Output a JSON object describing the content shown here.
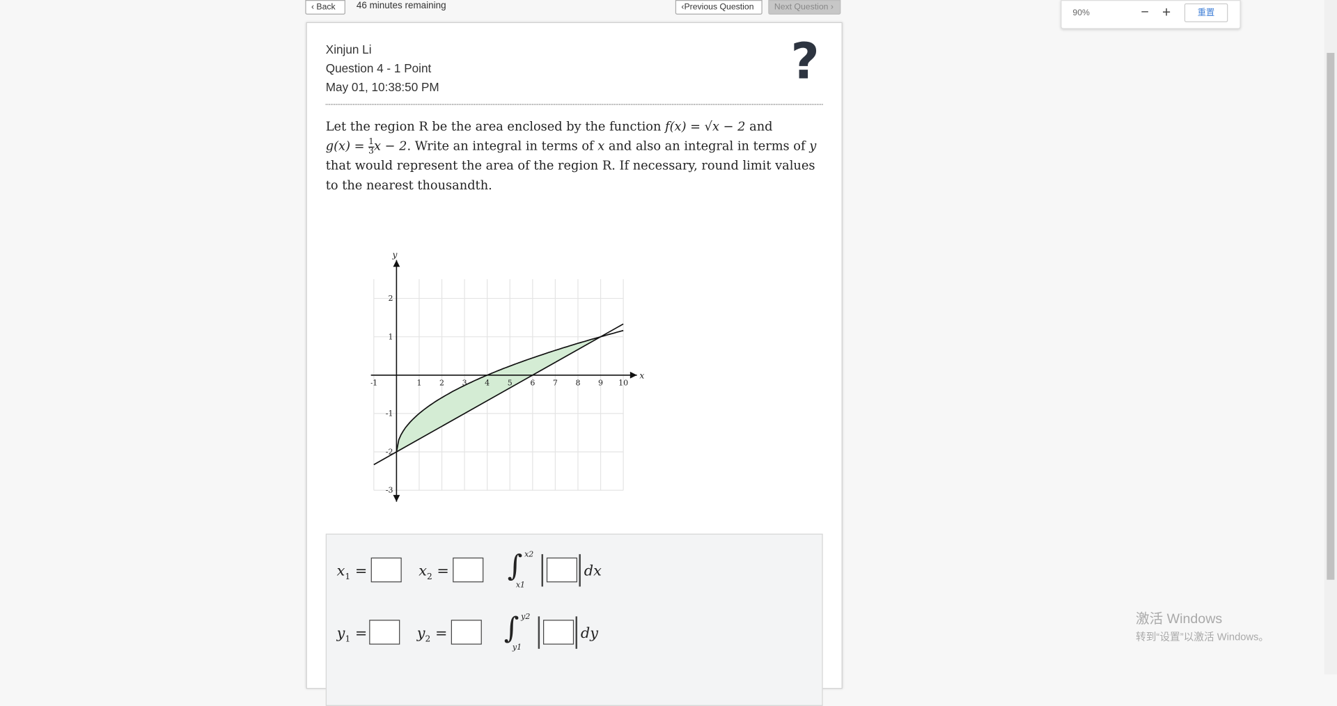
{
  "topbar": {
    "back_label": "Back",
    "timer": "46 minutes remaining",
    "prev_label": "Previous Question",
    "next_label": "Next Question"
  },
  "question": {
    "student": "Xinjun Li",
    "number_points": "Question 4 - 1 Point",
    "timestamp": "May 01, 10:38:50 PM",
    "prompt": {
      "p1": "Let the region R be the area enclosed by the function ",
      "f": "f(x) = √x − 2",
      "p2": " and",
      "g_pre": "g(x) = ",
      "g_post": "x − 2",
      "p3": ". Write an integral in terms of ",
      "x": "x",
      "p4": " and also an integral in terms of ",
      "y": "y",
      "p5": " that would represent the area of the region R. If necessary, round limit values to the nearest thousandth."
    }
  },
  "graph": {
    "x_axis_label": "x",
    "y_axis_label": "y",
    "x_ticks": [
      "-1",
      "1",
      "2",
      "3",
      "4",
      "5",
      "6",
      "7",
      "8",
      "9",
      "10"
    ],
    "y_ticks": [
      "2",
      "1",
      "-1",
      "-2",
      "-3"
    ],
    "region_fill": "#d4ecd4"
  },
  "answers": {
    "x1_label": "x",
    "x1_sub": "1",
    "x2_label": "x",
    "x2_sub": "2",
    "dx": "dx",
    "y1_label": "y",
    "y1_sub": "1",
    "y2_label": "y",
    "y2_sub": "2",
    "dy": "dy",
    "eq": "="
  },
  "zoom": {
    "level": "90%",
    "minus": "−",
    "plus": "+",
    "reset": "重置"
  },
  "watermark": {
    "line1": "激活 Windows",
    "line2": "转到“设置”以激活 Windows。"
  }
}
